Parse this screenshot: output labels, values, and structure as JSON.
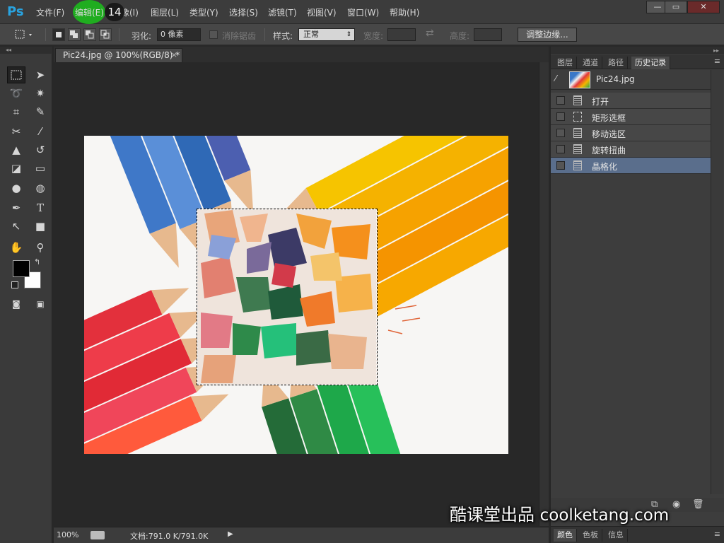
{
  "app": {
    "logo": "Ps",
    "menus": [
      "文件(F)",
      "编辑(E)",
      "图像(I)",
      "图层(L)",
      "类型(Y)",
      "选择(S)",
      "滤镜(T)",
      "视图(V)",
      "窗口(W)",
      "帮助(H)"
    ],
    "step_badge": "14",
    "window_controls": {
      "minimize": "—",
      "restore": "▭",
      "close": "✕"
    }
  },
  "options": {
    "feather_label": "羽化:",
    "feather_value": "0 像素",
    "antialias_label": "消除锯齿",
    "style_label": "样式:",
    "style_value": "正常",
    "width_label": "宽度:",
    "height_label": "高度:",
    "refine_edge_button": "调整边缘..."
  },
  "document": {
    "tab_title": "Pic24.jpg @ 100%(RGB/8) *",
    "tab_close": "×"
  },
  "status": {
    "zoom": "100%",
    "doc_size": "文档:791.0 K/791.0K"
  },
  "panels": {
    "tabs": [
      "图层",
      "通道",
      "路径",
      "历史记录"
    ],
    "active_tab": "历史记录",
    "snapshot_name": "Pic24.jpg",
    "history": [
      {
        "label": "打开",
        "icon": "document-icon"
      },
      {
        "label": "矩形选框",
        "icon": "marquee-icon"
      },
      {
        "label": "移动选区",
        "icon": "document-icon"
      },
      {
        "label": "旋转扭曲",
        "icon": "document-icon"
      },
      {
        "label": "晶格化",
        "icon": "document-icon"
      }
    ],
    "selected_index": 4,
    "bottom_tabs": [
      "颜色",
      "色板",
      "信息"
    ]
  },
  "watermark": {
    "cn": "酷课堂出品",
    "latin": "coolketang.com"
  },
  "colors": {
    "accent": "#29a3e0",
    "click_indicator": "#1fb31f",
    "history_selected": "#5a6e8c"
  }
}
